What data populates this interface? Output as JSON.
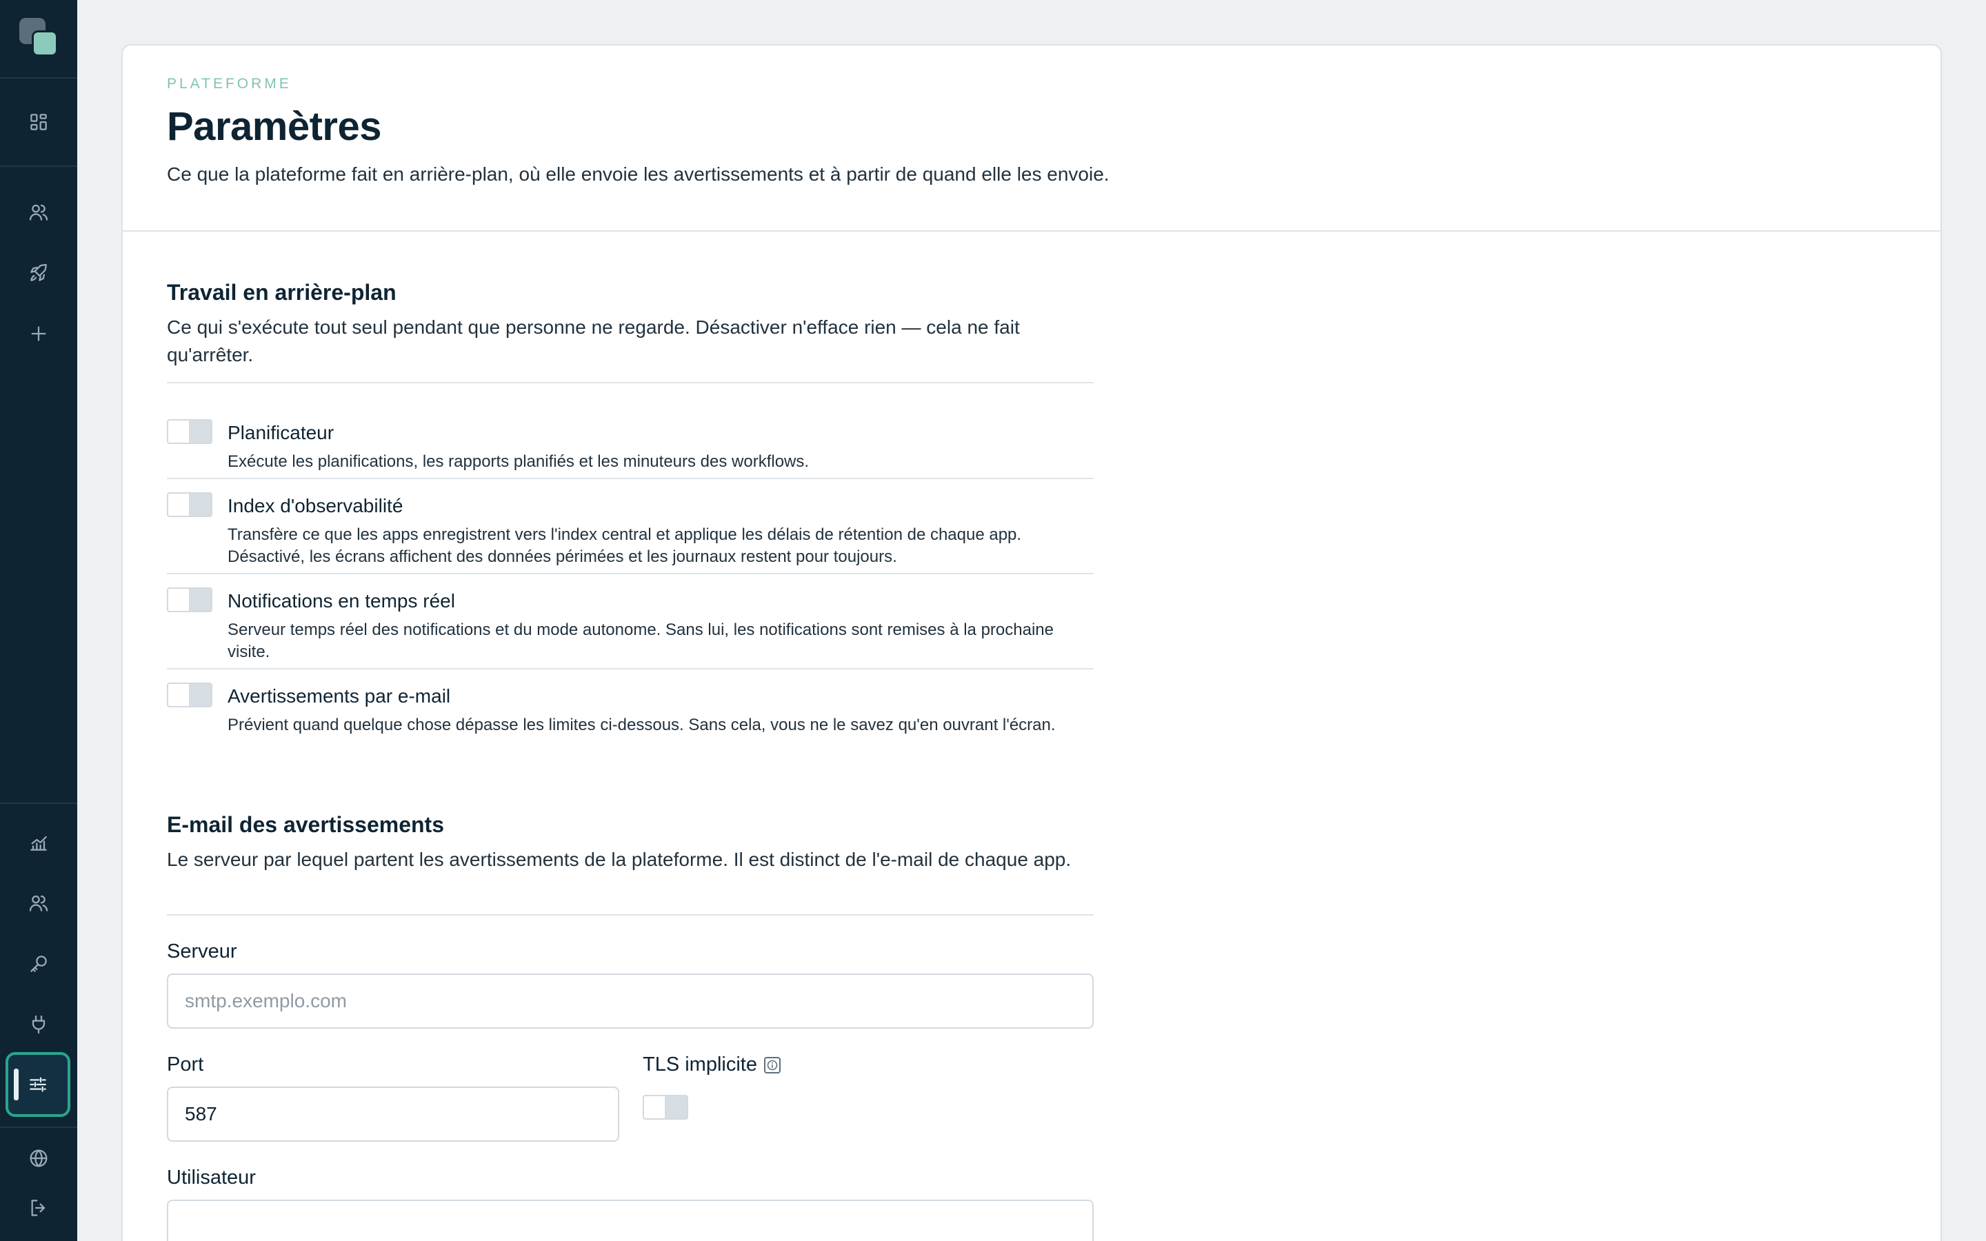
{
  "page": {
    "eyebrow": "PLATEFORME",
    "title": "Paramètres",
    "subtitle": "Ce que la plateforme fait en arrière-plan, où elle envoie les avertissements et à partir de quand elle les envoie."
  },
  "sidebar": {
    "top_items": [
      {
        "icon": "dashboard-icon"
      },
      {
        "icon": "users-icon"
      },
      {
        "icon": "rocket-icon"
      },
      {
        "icon": "plus-icon"
      }
    ],
    "bottom_items": [
      {
        "icon": "chart-icon"
      },
      {
        "icon": "users-icon"
      },
      {
        "icon": "key-icon"
      },
      {
        "icon": "plug-icon"
      },
      {
        "icon": "sliders-icon",
        "active": true
      },
      {
        "icon": "globe-icon"
      },
      {
        "icon": "logout-icon"
      }
    ],
    "accent": "#2aa58f"
  },
  "background": {
    "title": "Travail en arrière-plan",
    "description": "Ce qui s'exécute tout seul pendant que personne ne regarde. Désactiver n'efface rien — cela ne fait qu'arrêter.",
    "items": [
      {
        "label": "Planificateur",
        "description": "Exécute les planifications, les rapports planifiés et les minuteurs des workflows.",
        "enabled": false
      },
      {
        "label": "Index d'observabilité",
        "description": "Transfère ce que les apps enregistrent vers l'index central et applique les délais de rétention de chaque app. Désactivé, les écrans affichent des données périmées et les journaux restent pour toujours.",
        "enabled": false
      },
      {
        "label": "Notifications en temps réel",
        "description": "Serveur temps réel des notifications et du mode autonome. Sans lui, les notifications sont remises à la prochaine visite.",
        "enabled": false
      },
      {
        "label": "Avertissements par e-mail",
        "description": "Prévient quand quelque chose dépasse les limites ci-dessous. Sans cela, vous ne le savez qu'en ouvrant l'écran.",
        "enabled": false
      }
    ]
  },
  "email": {
    "title": "E-mail des avertissements",
    "description": "Le serveur par lequel partent les avertissements de la plateforme. Il est distinct de l'e-mail de chaque app.",
    "server_label": "Serveur",
    "server_placeholder": "smtp.exemplo.com",
    "server_value": "",
    "port_label": "Port",
    "port_value": "587",
    "tls_label": "TLS implicite",
    "tls_enabled": false,
    "user_label": "Utilisateur",
    "user_value": ""
  }
}
